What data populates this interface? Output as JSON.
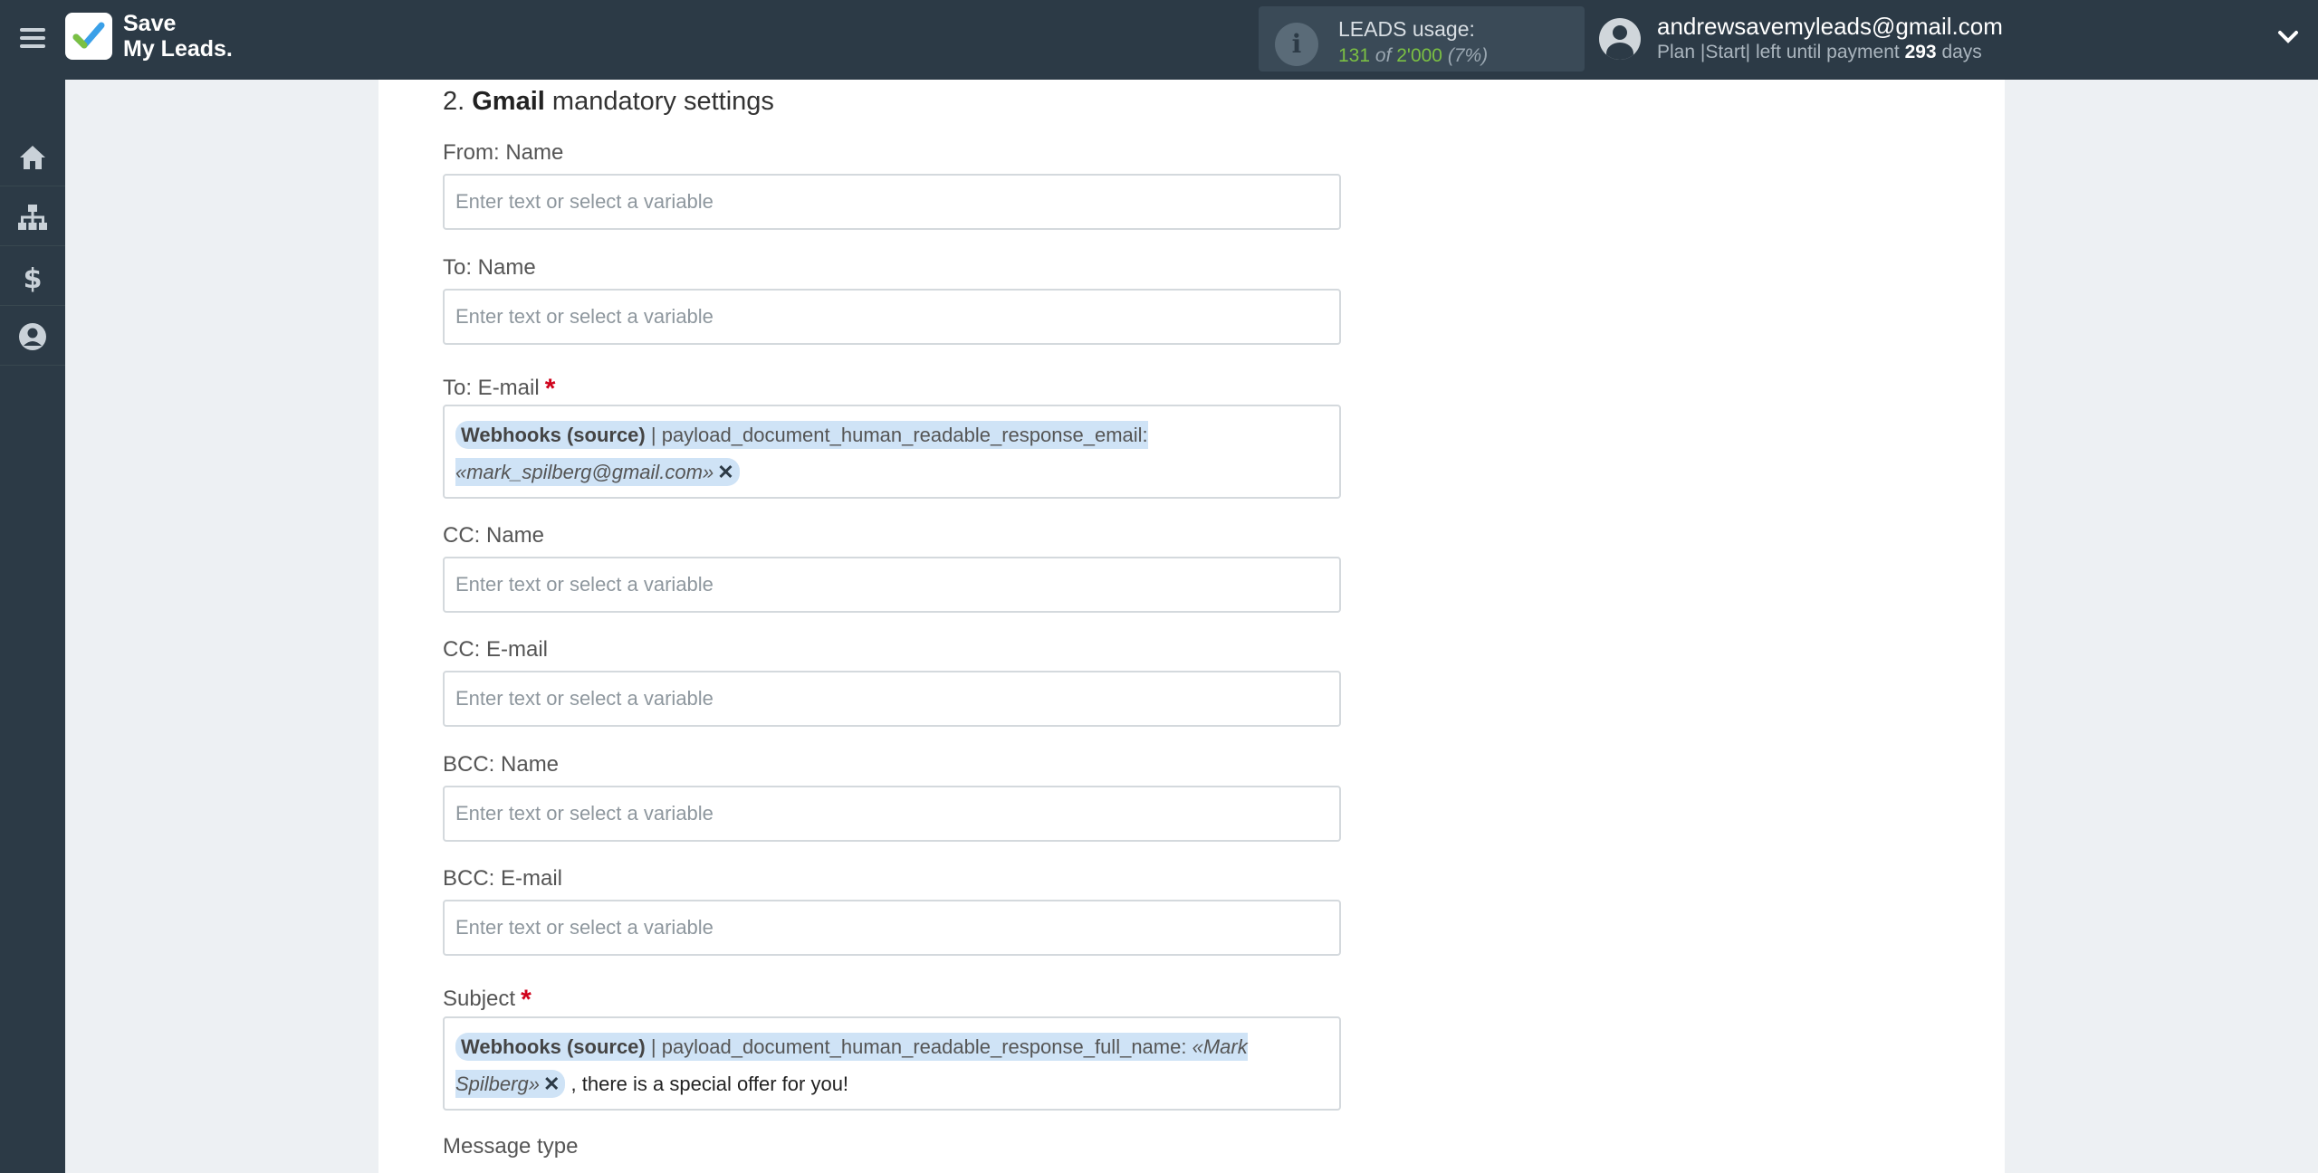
{
  "brand": {
    "line1": "Save",
    "line2": "My Leads."
  },
  "leads": {
    "title": "LEADS usage:",
    "used": "131",
    "of_word": "of",
    "total": "2'000",
    "percent": "(7%)"
  },
  "user": {
    "email": "andrewsavemyleads@gmail.com",
    "plan_prefix": "Plan |Start| left until payment",
    "days": "293",
    "days_suffix": "days"
  },
  "sidebar": [
    "home-icon",
    "sitemap-icon",
    "dollar-icon",
    "user-circle-icon"
  ],
  "section": {
    "number": "2.",
    "service": "Gmail",
    "title_rest": "mandatory settings"
  },
  "placeholder": "Enter text or select a variable",
  "fields": {
    "from_name": {
      "label": "From: Name",
      "value": ""
    },
    "to_name": {
      "label": "To: Name",
      "value": ""
    },
    "to_email": {
      "label": "To: E-mail",
      "required": "*",
      "tag": {
        "source": "Webhooks (source)",
        "sep": " | ",
        "field": "payload_document_human_readable_response_email:",
        "value": "«mark_spilberg@gmail.com»",
        "remove": "✕"
      }
    },
    "cc_name": {
      "label": "CC: Name",
      "value": ""
    },
    "cc_email": {
      "label": "CC: E-mail",
      "value": ""
    },
    "bcc_name": {
      "label": "BCC: Name",
      "value": ""
    },
    "bcc_email": {
      "label": "BCC: E-mail",
      "value": ""
    },
    "subject": {
      "label": "Subject",
      "required": "*",
      "tag": {
        "source": "Webhooks (source)",
        "sep": " | ",
        "field": "payload_document_human_readable_response_full_name:",
        "value_part1": "«Mark",
        "value_part2": "Spilberg»",
        "remove": "✕"
      },
      "trailing_text": ", there is a special offer for you!"
    },
    "message_type": {
      "label": "Message type"
    }
  },
  "colors": {
    "topbar": "#2c3a46",
    "tag_bg": "#cfe3f6",
    "required": "#d0021b",
    "used": "#7bc043"
  }
}
